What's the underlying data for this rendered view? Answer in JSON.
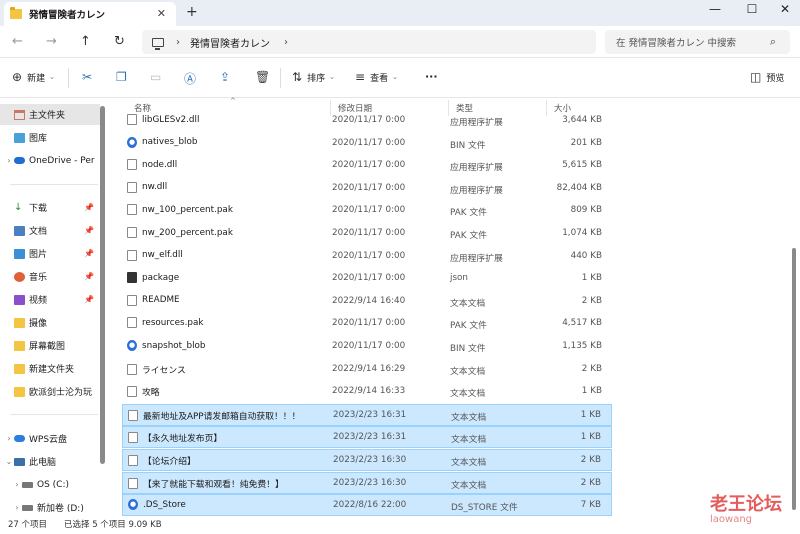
{
  "window": {
    "tab_title": "発情冒険者カレン",
    "tab_close": "✕",
    "new_tab": "+",
    "minimize": "—",
    "maximize": "☐",
    "close": "✕"
  },
  "navbar": {
    "back_icon": "←",
    "forward_icon": "→",
    "up_icon": "↑",
    "refresh_icon": "↻",
    "chevron": "›",
    "breadcrumb": "発情冒険者カレン",
    "search_placeholder": "在 発情冒険者カレン 中搜索",
    "search_icon": "⌕"
  },
  "toolbar": {
    "new_label": "新建",
    "sort_label": "排序",
    "view_label": "查看",
    "more_label": "···",
    "preview_label": "预览"
  },
  "sidebar": {
    "items": [
      {
        "label": "主文件夹",
        "icon": "home-icon"
      },
      {
        "label": "图库",
        "icon": "gallery-icon"
      },
      {
        "label": "OneDrive - Per",
        "icon": "onedrive-icon"
      },
      {
        "label": "下载",
        "icon": "download-icon"
      },
      {
        "label": "文档",
        "icon": "documents-icon"
      },
      {
        "label": "图片",
        "icon": "pictures-icon"
      },
      {
        "label": "音乐",
        "icon": "music-icon"
      },
      {
        "label": "视频",
        "icon": "videos-icon"
      },
      {
        "label": "摄像",
        "icon": "folder-icon"
      },
      {
        "label": "屏幕截图",
        "icon": "folder-icon"
      },
      {
        "label": "新建文件夹",
        "icon": "folder-icon"
      },
      {
        "label": "欧派剑士沦为玩",
        "icon": "folder-icon"
      },
      {
        "label": "WPS云盘",
        "icon": "wps-cloud-icon"
      },
      {
        "label": "此电脑",
        "icon": "this-pc-icon"
      },
      {
        "label": "OS (C:)",
        "icon": "drive-icon"
      },
      {
        "label": "新加卷 (D:)",
        "icon": "drive-icon"
      }
    ],
    "pin": "📌"
  },
  "columns": {
    "name": "名称",
    "date": "修改日期",
    "type": "类型",
    "size": "大小"
  },
  "files": [
    {
      "name": "libGLESv2.dll",
      "date": "2020/11/17 0:00",
      "type": "应用程序扩展",
      "size": "3,644 KB",
      "icon": "dll",
      "selected": false
    },
    {
      "name": "natives_blob",
      "date": "2020/11/17 0:00",
      "type": "BIN 文件",
      "size": "201 KB",
      "icon": "blob",
      "selected": false
    },
    {
      "name": "node.dll",
      "date": "2020/11/17 0:00",
      "type": "应用程序扩展",
      "size": "5,615 KB",
      "icon": "dll",
      "selected": false
    },
    {
      "name": "nw.dll",
      "date": "2020/11/17 0:00",
      "type": "应用程序扩展",
      "size": "82,404 KB",
      "icon": "dll",
      "selected": false
    },
    {
      "name": "nw_100_percent.pak",
      "date": "2020/11/17 0:00",
      "type": "PAK 文件",
      "size": "809 KB",
      "icon": "doc",
      "selected": false
    },
    {
      "name": "nw_200_percent.pak",
      "date": "2020/11/17 0:00",
      "type": "PAK 文件",
      "size": "1,074 KB",
      "icon": "doc",
      "selected": false
    },
    {
      "name": "nw_elf.dll",
      "date": "2020/11/17 0:00",
      "type": "应用程序扩展",
      "size": "440 KB",
      "icon": "dll",
      "selected": false
    },
    {
      "name": "package",
      "date": "2020/11/17 0:00",
      "type": "json",
      "size": "1 KB",
      "icon": "pkg",
      "selected": false
    },
    {
      "name": "README",
      "date": "2022/9/14 16:40",
      "type": "文本文档",
      "size": "2 KB",
      "icon": "doc",
      "selected": false
    },
    {
      "name": "resources.pak",
      "date": "2020/11/17 0:00",
      "type": "PAK 文件",
      "size": "4,517 KB",
      "icon": "doc",
      "selected": false
    },
    {
      "name": "snapshot_blob",
      "date": "2020/11/17 0:00",
      "type": "BIN 文件",
      "size": "1,135 KB",
      "icon": "blob",
      "selected": false
    },
    {
      "name": "ライセンス",
      "date": "2022/9/14 16:29",
      "type": "文本文档",
      "size": "2 KB",
      "icon": "doc",
      "selected": false
    },
    {
      "name": "攻略",
      "date": "2022/9/14 16:33",
      "type": "文本文档",
      "size": "1 KB",
      "icon": "doc",
      "selected": false
    },
    {
      "name": "最新地址及APP请发邮箱自动获取！！！",
      "date": "2023/2/23 16:31",
      "type": "文本文档",
      "size": "1 KB",
      "icon": "doc",
      "selected": true
    },
    {
      "name": "【永久地址发布页】",
      "date": "2023/2/23 16:31",
      "type": "文本文档",
      "size": "1 KB",
      "icon": "doc",
      "selected": true
    },
    {
      "name": "【论坛介绍】",
      "date": "2023/2/23 16:30",
      "type": "文本文档",
      "size": "2 KB",
      "icon": "doc",
      "selected": true
    },
    {
      "name": "【来了就能下载和观看！纯免费！】",
      "date": "2023/2/23 16:30",
      "type": "文本文档",
      "size": "2 KB",
      "icon": "doc",
      "selected": true
    },
    {
      "name": ".DS_Store",
      "date": "2022/8/16 22:00",
      "type": "DS_STORE 文件",
      "size": "7 KB",
      "icon": "blob",
      "selected": true
    }
  ],
  "status": {
    "count": "27 个项目",
    "selection": "已选择 5 个项目  9.09 KB"
  },
  "watermark": {
    "text": "老王论坛",
    "sub": "laowang"
  }
}
